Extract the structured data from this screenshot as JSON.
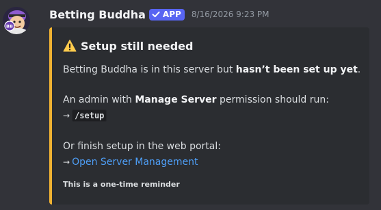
{
  "message": {
    "avatar_icon": "betting-buddha-avatar-icon",
    "avatar_text": "BB",
    "username": "Betting Buddha",
    "app_tag": "APP",
    "timestamp": "8/16/2026 9:23 PM"
  },
  "embed": {
    "accent_color": "#f0b232",
    "title": "Setup still needed",
    "title_icon": "warning-icon",
    "line1": {
      "prefix": "Betting Buddha is in this server but ",
      "bold": "hasn’t been set up yet",
      "suffix": "."
    },
    "line2": {
      "prefix": "An admin with ",
      "bold": "Manage Server",
      "suffix": " permission should run:"
    },
    "command_arrow": "→",
    "command": "/setup",
    "line3": "Or finish setup in the web portal:",
    "link_arrow": "→",
    "link_text": "Open Server Management",
    "footer": "This is a one-time reminder"
  },
  "colors": {
    "background": "#323339",
    "embed_background": "#2b2d31",
    "app_tag": "#5865f2",
    "link": "#4e9ef6"
  }
}
